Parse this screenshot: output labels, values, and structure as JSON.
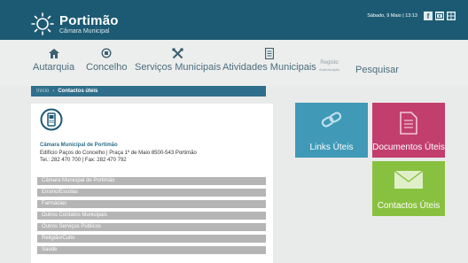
{
  "header": {
    "logo_title": "Portimão",
    "logo_subtitle": "Câmara Municipal",
    "date_text": "Sábado, 9 Maio | 13:13",
    "social_icons": [
      "facebook-icon",
      "youtube-icon",
      "grid-icon"
    ]
  },
  "nav": {
    "items": [
      {
        "label": "Autarquia",
        "icon": "house-icon"
      },
      {
        "label": "Concelho",
        "icon": "emblem-icon"
      },
      {
        "label": "Serviços Municipais",
        "icon": "tools-icon"
      },
      {
        "label": "Atividades Municipais",
        "icon": "list-icon"
      }
    ],
    "registo_line1": "Registo",
    "registo_line2": "Autenticação",
    "search_label": "Pesquisar"
  },
  "breadcrumb": {
    "home": "Início",
    "separator": "›",
    "current": "Contactos úteis"
  },
  "contact": {
    "icon": "phone-icon",
    "name": "Câmara Municipal de Portimão",
    "address": "Edifício Paços do Concelho  |  Praça 1º de Maio 8500-543 Portimão",
    "phones": "Tel.: 282 470 700  |  Fax: 282 470 792"
  },
  "list": [
    "Câmara Municipal de Portimão",
    "Ensino/Escolas",
    "Farmácias",
    "Outros Contatos Municipais",
    "Outros Serviços Públicos",
    "Religião/Culto",
    "Saúde"
  ],
  "tiles": {
    "links_label": "Links Úteis",
    "docs_label": "Documentos Úteis",
    "contacts_label": "Contactos Úteis"
  },
  "colors": {
    "header": "#1c5a73",
    "links": "#3f99b7",
    "docs": "#c23e6d",
    "contacts": "#88c13f"
  }
}
